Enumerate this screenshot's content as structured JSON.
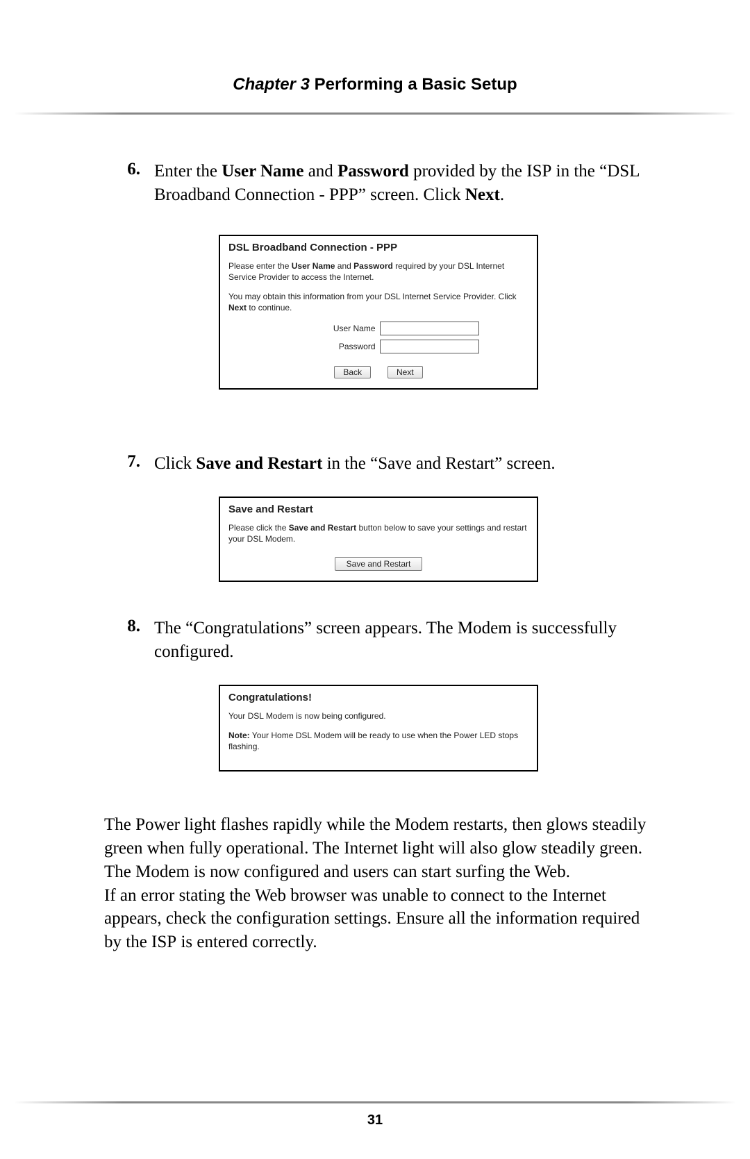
{
  "header": {
    "chapter_label": "Chapter 3",
    "chapter_title": "  Performing a Basic Setup"
  },
  "steps": {
    "s6": {
      "num": "6.",
      "text_before": "Enter the ",
      "bold1": "User Name",
      "mid1": " and ",
      "bold2": "Password",
      "mid2": " provided by the ",
      "isp": "ISP",
      "mid3": " in the “",
      "dsl": "DSL",
      "mid4": " Broadband Connection - ",
      "ppp": "PPP",
      "mid5": "” screen. Click ",
      "bold3": "Next",
      "tail": "."
    },
    "s7": {
      "num": "7.",
      "lead": "Click ",
      "bold1": "Save and Restart",
      "tail": " in the “Save and Restart” screen."
    },
    "s8": {
      "num": "8.",
      "text": "The “Congratulations” screen appears. The Modem is successfully configured."
    }
  },
  "screenshot1": {
    "title": "DSL Broadband Connection - PPP",
    "p1_pre": "Please enter the ",
    "p1_b1": "User Name",
    "p1_mid": " and ",
    "p1_b2": "Password",
    "p1_post": " required by your DSL Internet Service Provider to access the Internet.",
    "p2_pre": "You may obtain this information from your DSL Internet Service Provider. Click ",
    "p2_b": "Next",
    "p2_post": " to continue.",
    "label_user": "User Name",
    "label_pass": "Password",
    "value_user": "",
    "value_pass": "",
    "btn_back": "Back",
    "btn_next": "Next"
  },
  "screenshot2": {
    "title": "Save and Restart",
    "p1_pre": "Please click the ",
    "p1_b": "Save and Restart",
    "p1_post": " button below to save your settings and restart your DSL Modem.",
    "btn": "Save and Restart"
  },
  "screenshot3": {
    "title": "Congratulations!",
    "p1": "Your DSL Modem is now being configured.",
    "p2_b": "Note:",
    "p2": " Your Home DSL Modem will be ready to use when the Power LED stops flashing."
  },
  "body_para_a": "The Power light flashes rapidly while the Modem restarts, then glows steadily green when fully operational. The Internet light will also glow steadily green. The Modem is now configured and users can start surfing the Web.",
  "body_para_b_pre": "If an error stating the Web browser was unable to connect to the Internet appears, check the configuration settings. Ensure all the information required by the ",
  "body_para_b_isp": "ISP",
  "body_para_b_post": " is entered correctly.",
  "page_number": "31"
}
